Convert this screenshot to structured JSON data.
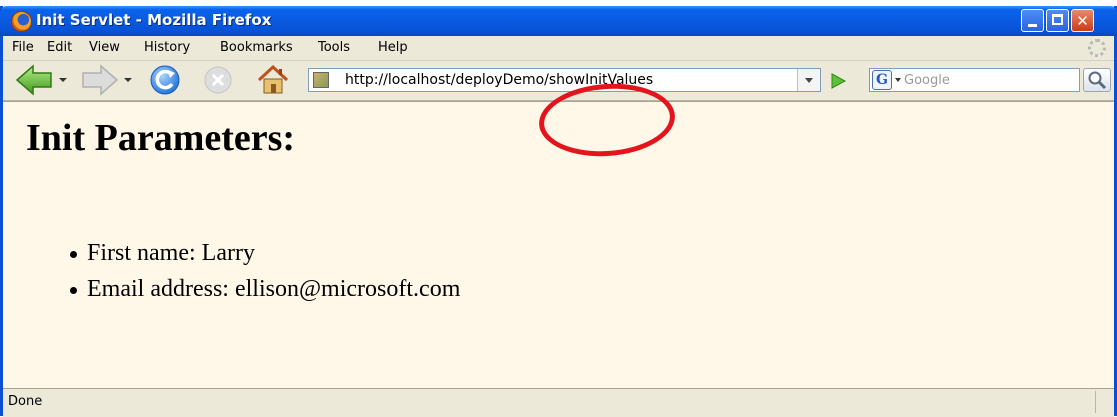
{
  "window": {
    "title": "Init Servlet - Mozilla Firefox",
    "controls": [
      "minimize",
      "maximize",
      "close"
    ]
  },
  "menu": {
    "items": [
      {
        "label": "File"
      },
      {
        "label": "Edit"
      },
      {
        "label": "View"
      },
      {
        "label": "History"
      },
      {
        "label": "Bookmarks"
      },
      {
        "label": "Tools"
      },
      {
        "label": "Help"
      }
    ]
  },
  "toolbar": {
    "buttons": [
      "back-icon",
      "forward-icon",
      "reload-icon",
      "stop-icon",
      "home-icon"
    ],
    "address": "http://localhost/deployDemo/showInitValues",
    "search_placeholder": "Google",
    "search_engine_letter": "G"
  },
  "page": {
    "heading": "Init Parameters:",
    "params": [
      {
        "text": "First name: Larry"
      },
      {
        "text": "Email address: ellison@microsoft.com"
      }
    ]
  },
  "status": {
    "text": "Done"
  },
  "colors": {
    "titlebar": "#0a5ae0",
    "content_bg": "#fff7e8",
    "annotation": "#e4141c"
  }
}
